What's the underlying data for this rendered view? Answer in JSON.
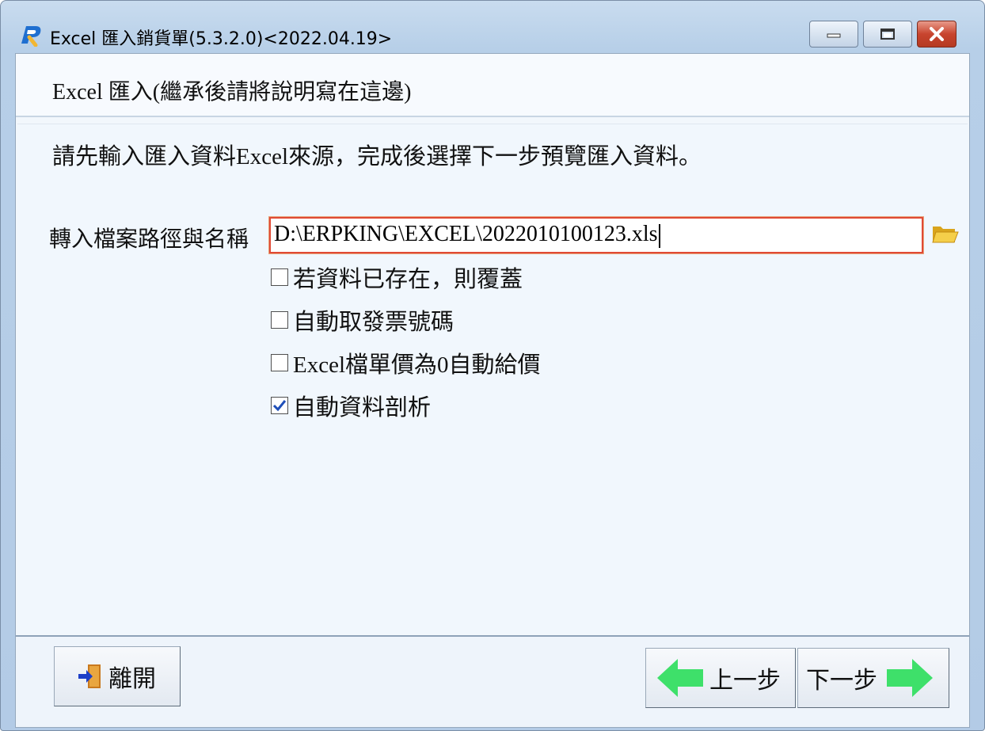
{
  "window": {
    "title": "Excel 匯入銷貨單(5.3.2.0)<2022.04.19>",
    "icons": [
      "app-logo-icon",
      "minimize-icon",
      "maximize-icon",
      "close-icon"
    ]
  },
  "header": {
    "title": "Excel 匯入(繼承後請將說明寫在這邊)"
  },
  "content": {
    "instruction": "請先輸入匯入資料Excel來源，完成後選擇下一步預覽匯入資料。",
    "path_label": "轉入檔案路徑與名稱",
    "path_value": "D:\\ERPKING\\EXCEL\\2022010100123.xls",
    "checkboxes": [
      {
        "label": "若資料已存在，則覆蓋",
        "checked": false
      },
      {
        "label": "自動取發票號碼",
        "checked": false
      },
      {
        "label": "Excel檔單價為0自動給價",
        "checked": false
      },
      {
        "label": "自動資料剖析",
        "checked": true
      }
    ]
  },
  "footer": {
    "exit_label": "離開",
    "prev_label": "上一步",
    "next_label": "下一步"
  },
  "colors": {
    "accent_border": "#e04a35",
    "arrow_green": "#3ee06a",
    "checkmark_blue": "#1f4fb8"
  }
}
